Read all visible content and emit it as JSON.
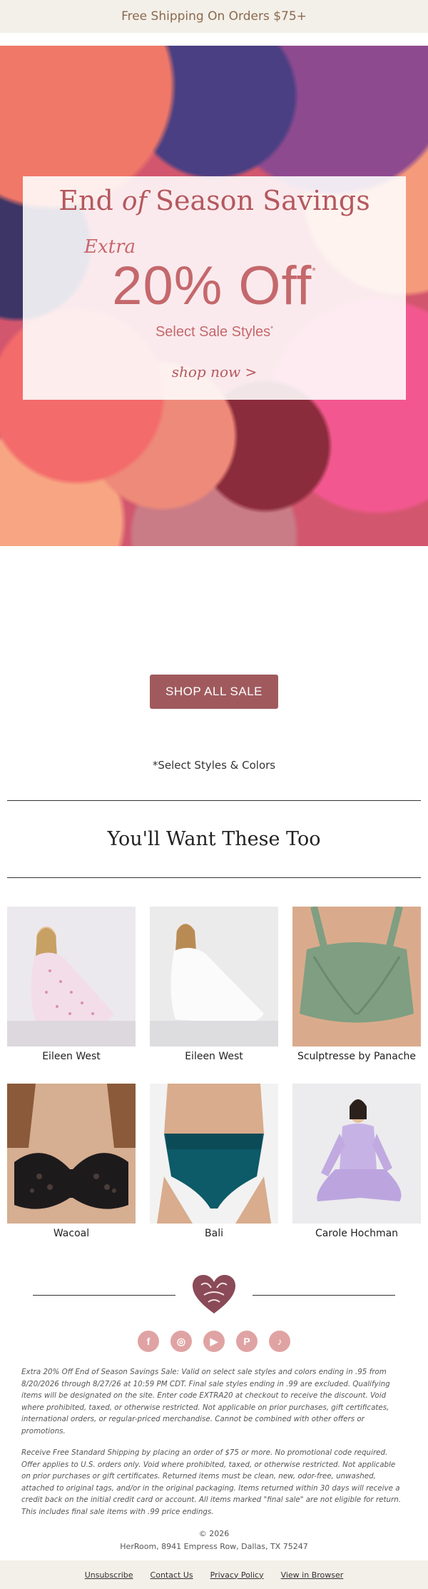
{
  "topbar": {
    "text": "Free Shipping On Orders $75+"
  },
  "hero": {
    "title_a": "End ",
    "title_of": "of",
    "title_b": " Season Savings",
    "extra": "Extra",
    "off": "20% Off",
    "off_mark": "*",
    "sub": "Select Sale Styles",
    "sub_mark": "*",
    "shop_now": "shop now >"
  },
  "cta": {
    "label": "SHOP ALL SALE"
  },
  "note": "*Select Styles & Colors",
  "section": {
    "title": "You'll Want These Too"
  },
  "products": [
    {
      "name": "Eileen West"
    },
    {
      "name": "Eileen West"
    },
    {
      "name": "Sculptresse by Panache"
    },
    {
      "name": "Wacoal"
    },
    {
      "name": "Bali"
    },
    {
      "name": "Carole Hochman"
    }
  ],
  "social": [
    "facebook-icon",
    "instagram-icon",
    "youtube-icon",
    "pinterest-icon",
    "tiktok-icon"
  ],
  "legal": {
    "p1": "Extra 20% Off End of Season Savings Sale: Valid on select sale styles and colors ending in .95 from 8/20/2026 through 8/27/26 at 10:59 PM CDT. Final sale styles ending in .99 are excluded. Qualifying items will be designated on the site. Enter code EXTRA20 at checkout to receive the discount. Void where prohibited, taxed, or otherwise restricted. Not applicable on prior purchases, gift certificates, international orders, or regular-priced merchandise. Cannot be combined with other offers or promotions.",
    "p2": "Receive Free Standard Shipping by placing an order of $75 or more. No promotional code required. Offer applies to U.S. orders only. Void where prohibited, taxed, or otherwise restricted. Not applicable on prior purchases or gift certificates. Returned items must be clean, new, odor-free, unwashed, attached to original tags, and/or in the original packaging. Items returned within 30 days will receive a credit back on the initial credit card or account. All items marked \"final sale\" are not eligible for return. This includes final sale items with .99 price endings."
  },
  "copyright": "© 2026",
  "address": "HerRoom, 8941 Empress Row, Dallas, TX 75247",
  "footer": {
    "unsubscribe": "Unsubscribe",
    "contact": "Contact Us",
    "privacy": "Privacy Policy",
    "browser": "View in Browser"
  },
  "colors": {
    "accent": "#a05a5e",
    "hero_text": "#c4686c",
    "band": "#f3efe9",
    "social": "#e0a3a3"
  }
}
